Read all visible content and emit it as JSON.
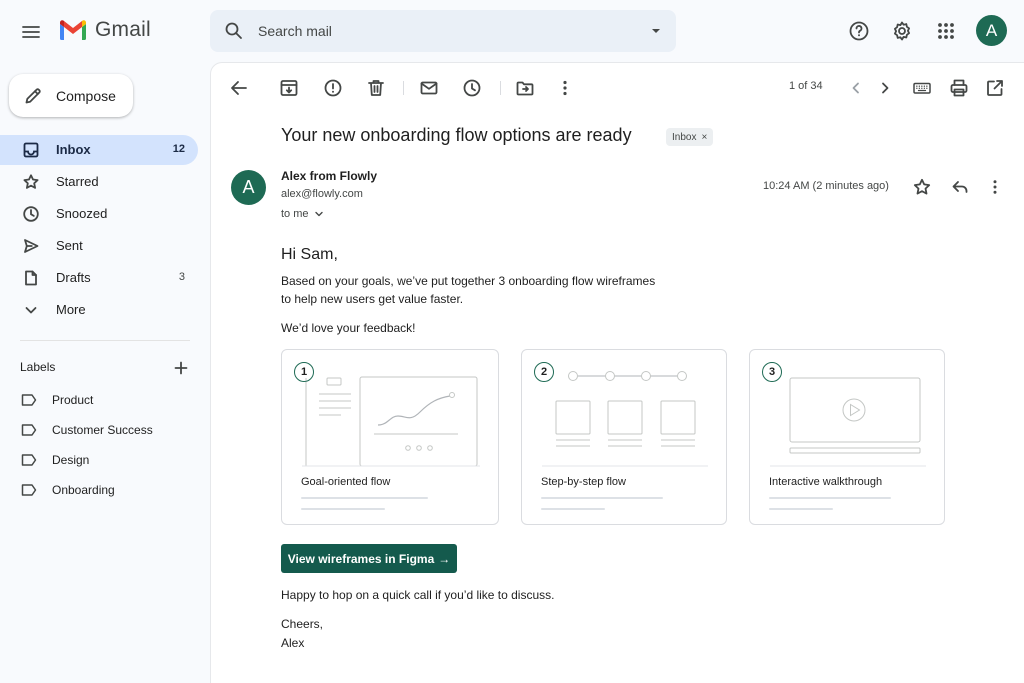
{
  "app": {
    "name": "Gmail"
  },
  "colors": {
    "accent": "#1e6a54",
    "cta": "#145a4d",
    "active_nav": "#d3e3fd"
  },
  "search": {
    "placeholder": "Search mail"
  },
  "account": {
    "initial": "A"
  },
  "sidebar": {
    "compose_label": "Compose",
    "items": [
      {
        "label": "Inbox",
        "count": "12",
        "icon": "inbox-icon",
        "active": true
      },
      {
        "label": "Starred",
        "count": "",
        "icon": "star-icon"
      },
      {
        "label": "Snoozed",
        "count": "",
        "icon": "clock-icon"
      },
      {
        "label": "Sent",
        "count": "",
        "icon": "send-icon"
      },
      {
        "label": "Drafts",
        "count": "3",
        "icon": "file-icon"
      },
      {
        "label": "More",
        "count": "",
        "icon": "chevron-down-icon"
      }
    ],
    "labels_title": "Labels",
    "labels": [
      "Product",
      "Customer Success",
      "Design",
      "Onboarding"
    ]
  },
  "toolbar": {
    "pager": "1 of 34"
  },
  "email": {
    "subject": "Your new onboarding flow options are ready",
    "chip": "Inbox",
    "chip_close": "×",
    "sender_initial": "A",
    "sender_name": "Alex from Flowly",
    "sender_email": "alex@flowly.com",
    "to": "to me",
    "timestamp": "10:24 AM (2 minutes ago)",
    "greeting": "Hi Sam,",
    "line1": "Based on your goals, we’ve put together 3 onboarding flow wireframes",
    "line2": "to help new users get value faster.",
    "line3": "We’d love your feedback!",
    "cards": [
      {
        "num": "1",
        "title": "Goal-oriented flow"
      },
      {
        "num": "2",
        "title": "Step-by-step flow"
      },
      {
        "num": "3",
        "title": "Interactive walkthrough"
      }
    ],
    "cta_label": "View wireframes in Figma",
    "cta_arrow": "→",
    "closing1": "Happy to hop on a quick call if you’d like to discuss.",
    "closing2": "Cheers,",
    "closing3": "Alex"
  }
}
